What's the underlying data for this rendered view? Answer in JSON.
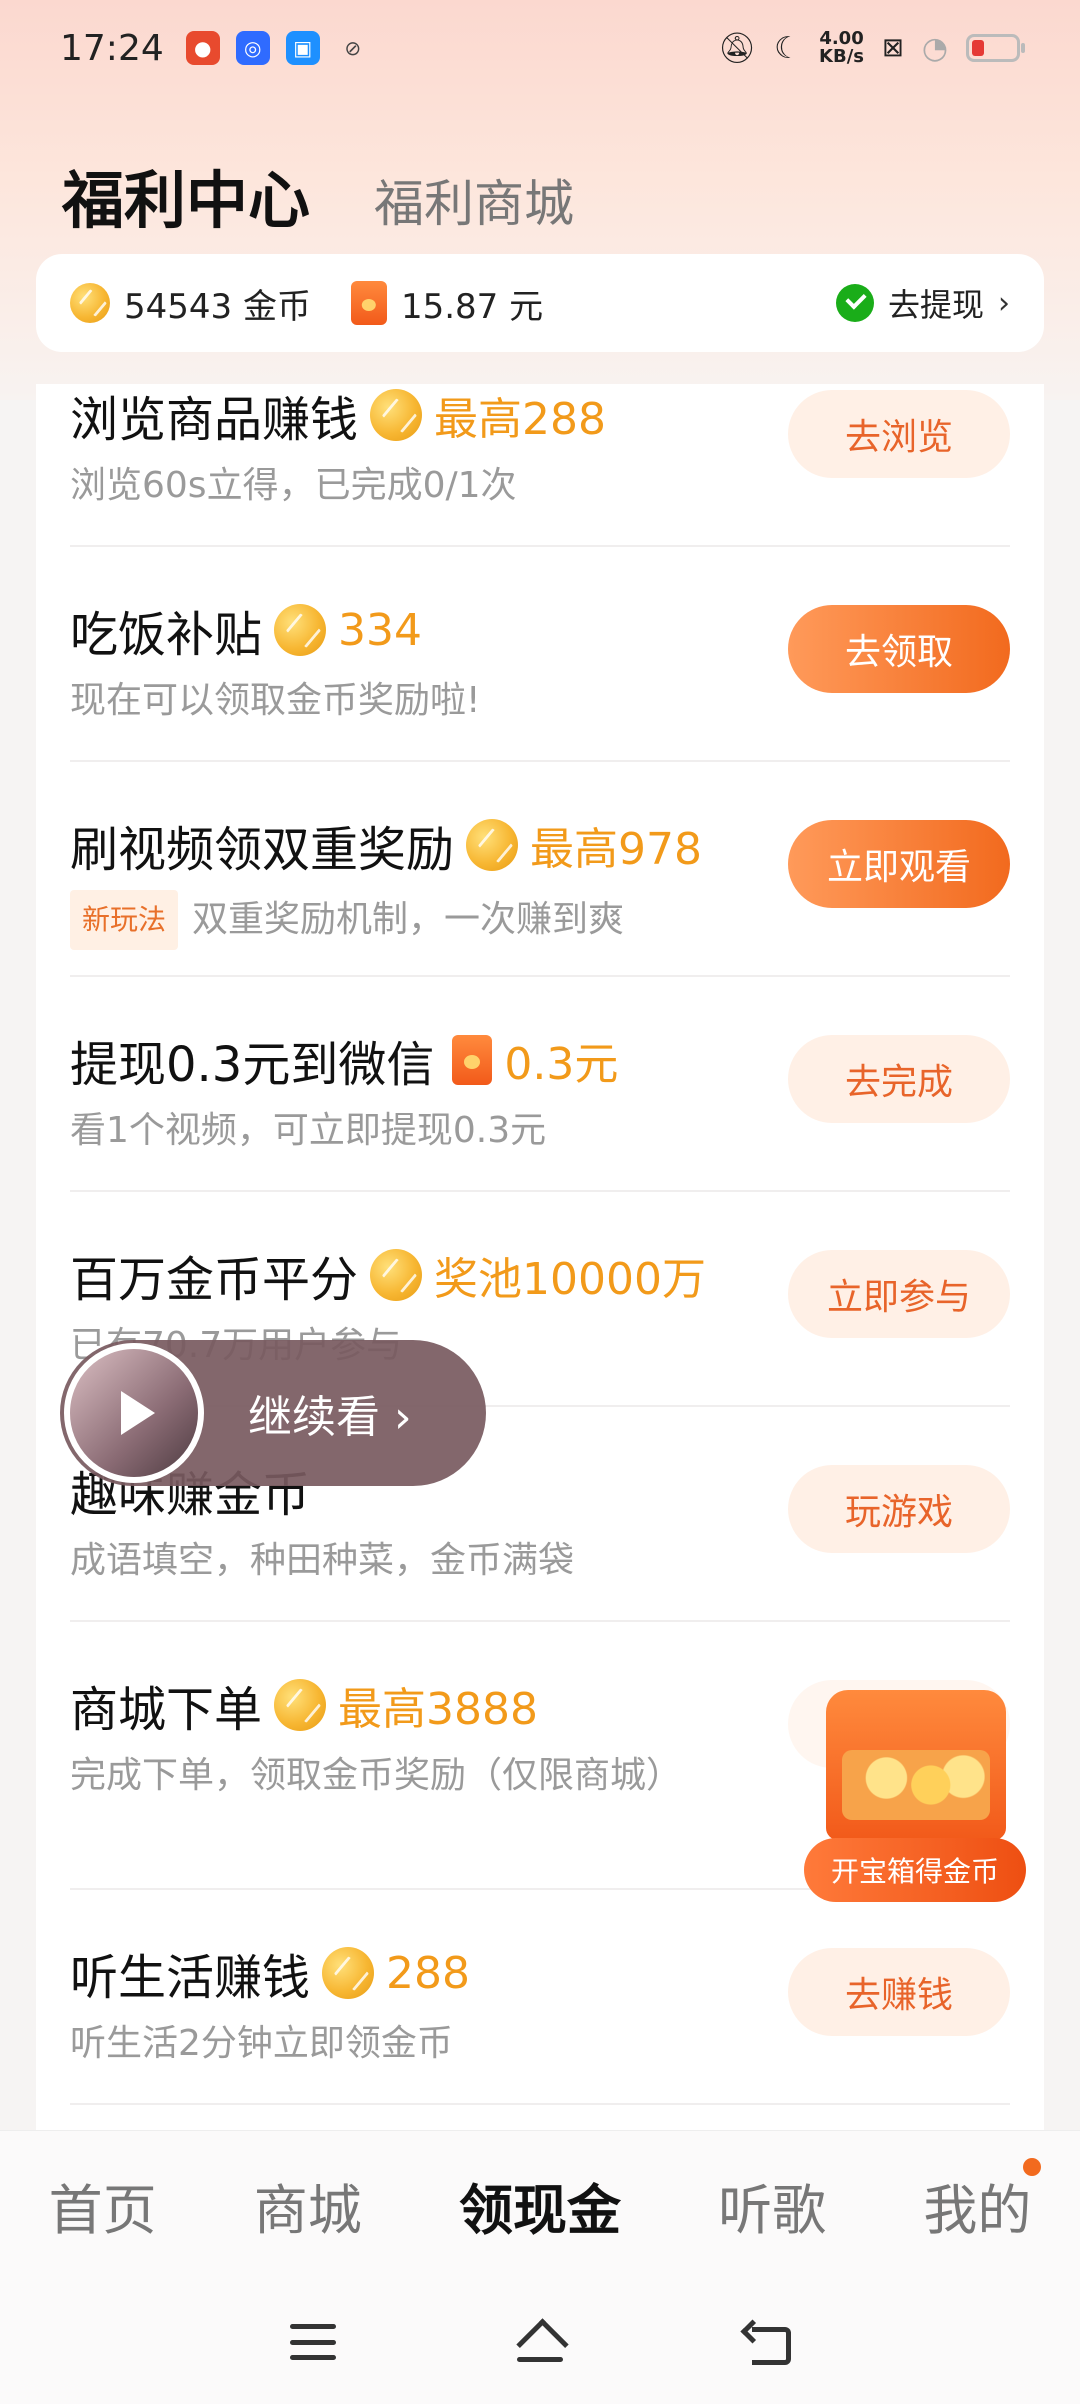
{
  "status_bar": {
    "time": "17:24",
    "net_speed_value": "4.00",
    "net_speed_unit": "KB/s"
  },
  "header": {
    "title": "福利中心",
    "secondary_tab": "福利商城"
  },
  "balance": {
    "coins": "54543 金币",
    "cash": "15.87 元",
    "withdraw_label": "去提现"
  },
  "tasks": [
    {
      "title": "浏览商品赚钱",
      "reward": "最高288",
      "desc": "浏览60s立得，已完成0/1次",
      "button": "去浏览"
    },
    {
      "title": "吃饭补贴",
      "reward": "334",
      "desc": "现在可以领取金币奖励啦!",
      "button": "去领取"
    },
    {
      "title": "刷视频领双重奖励",
      "reward": "最高978",
      "tag": "新玩法",
      "desc": "双重奖励机制，一次赚到爽",
      "button": "立即观看"
    },
    {
      "title": "提现0.3元到微信",
      "reward": "0.3元",
      "desc": "看1个视频，可立即提现0.3元",
      "button": "去完成"
    },
    {
      "title": "百万金币平分",
      "reward": "奖池10000万",
      "desc": "已有70.7万用户参与",
      "button": "立即参与"
    },
    {
      "title": "趣味赚金币",
      "desc": "成语填空，种田种菜，金币满袋",
      "button": "玩游戏"
    },
    {
      "title": "商城下单",
      "reward": "最高3888",
      "desc": "完成下单，领取金币奖励（仅限商城）",
      "button": ""
    },
    {
      "title": "听生活赚钱",
      "reward": "288",
      "desc": "听生活2分钟立即领金币",
      "button": "去赚钱"
    }
  ],
  "treasure_chest": {
    "label": "开宝箱得金币"
  },
  "continue_watch": {
    "label": "继续看 ›"
  },
  "tab_bar": {
    "tabs": [
      "首页",
      "商城",
      "领现金",
      "听歌",
      "我的"
    ],
    "active": "领现金"
  },
  "colors": {
    "accent_orange": "#f26a1e",
    "reward_gold": "#f29a1a",
    "header_pink": "#fbd8cf"
  }
}
